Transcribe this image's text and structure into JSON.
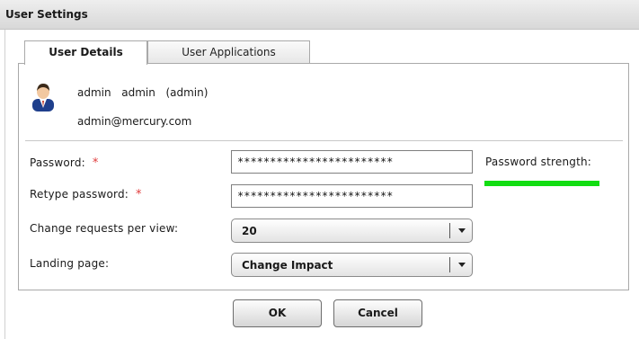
{
  "window": {
    "title": "User Settings"
  },
  "tabs": [
    {
      "label": "User Details",
      "active": true
    },
    {
      "label": "User Applications",
      "active": false
    }
  ],
  "user": {
    "display": "admin  admin  (admin)",
    "email": "admin@mercury.com",
    "avatar_icon": "user-avatar-icon"
  },
  "form": {
    "password": {
      "label": "Password:",
      "required_mark": "*",
      "value": "************************"
    },
    "retype_password": {
      "label": "Retype password:",
      "required_mark": "*",
      "value": "************************"
    },
    "change_requests": {
      "label": "Change requests per view:",
      "value": "20"
    },
    "landing_page": {
      "label": "Landing page:",
      "value": "Change Impact"
    },
    "password_strength": {
      "label": "Password strength:",
      "color": "#12dd12"
    }
  },
  "buttons": {
    "ok": "OK",
    "cancel": "Cancel"
  },
  "colors": {
    "required": "#e03c3c",
    "strength": "#12dd12"
  }
}
